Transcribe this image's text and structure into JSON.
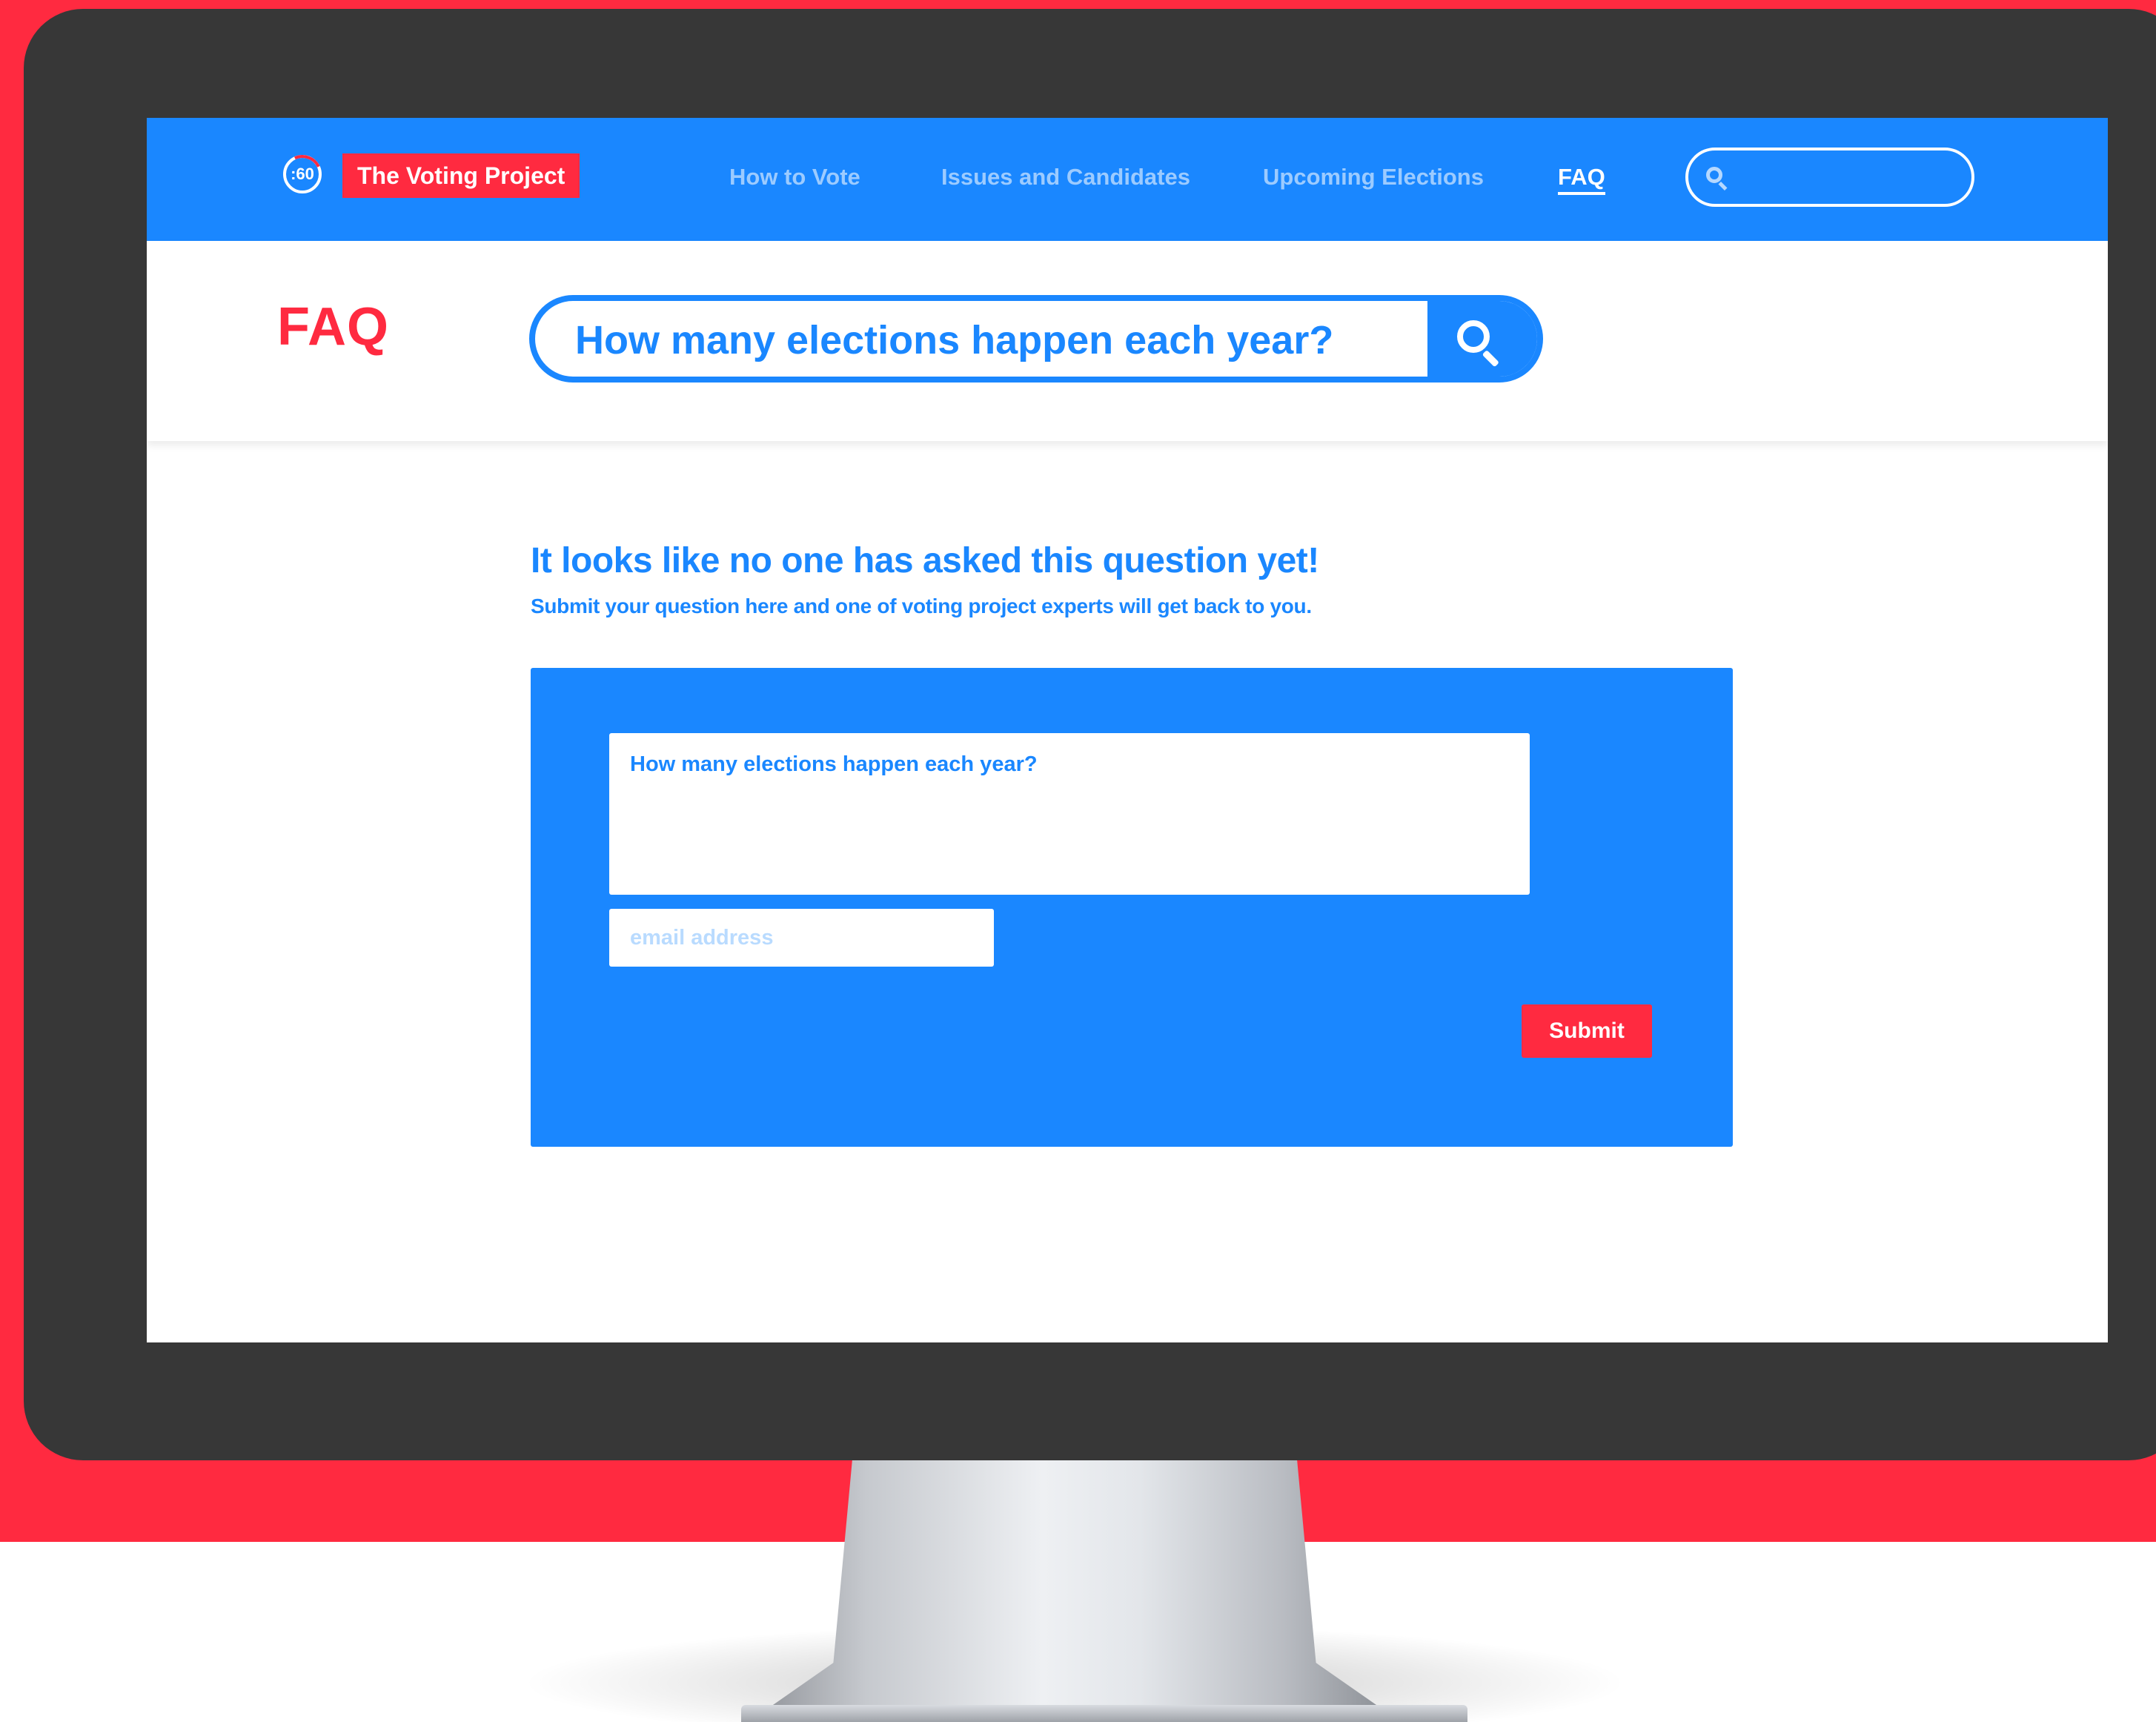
{
  "colors": {
    "primary_blue": "#1a87ff",
    "accent_red": "#ff2a40",
    "bezel": "#373737",
    "nav_link_inactive": "#9ccbff"
  },
  "nav": {
    "logo_text": ":60",
    "brand": "The Voting Project",
    "links": [
      {
        "label": "How to Vote",
        "active": false
      },
      {
        "label": "Issues and Candidates",
        "active": false
      },
      {
        "label": "Upcoming Elections",
        "active": false
      },
      {
        "label": "FAQ",
        "active": true
      }
    ],
    "search": {
      "value": "",
      "icon": "search-icon"
    }
  },
  "header": {
    "title": "FAQ",
    "search_value": "How many elections happen each year?",
    "search_icon": "search-icon"
  },
  "content": {
    "heading": "It looks like no one has asked this question yet!",
    "subheading": "Submit your question here and one of voting project experts will get back to you.",
    "form": {
      "question_value": "How many elections happen each year?",
      "email_placeholder": "email address",
      "submit_label": "Submit"
    }
  }
}
